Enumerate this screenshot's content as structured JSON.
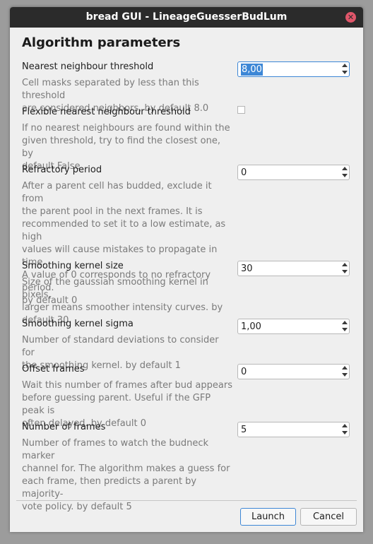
{
  "window": {
    "title": "bread GUI - LineageGuesserBudLum",
    "close_icon": "close-icon"
  },
  "heading": "Algorithm parameters",
  "params": [
    {
      "name": "Nearest neighbour threshold",
      "value": "8,00",
      "widget": "spinbox",
      "desc": [
        "Cell masks separated by less than this threshold",
        "are considered neighbors, by default 8.0"
      ]
    },
    {
      "name": "Flexible nearest neighbour threshold",
      "value": "unchecked",
      "widget": "checkbox",
      "desc": [
        "If no nearest neighbours are found within the",
        "given threshold, try to find the closest one, by",
        "default False"
      ]
    },
    {
      "name": "Refractory period",
      "value": "0",
      "widget": "spinbox",
      "desc": [
        "After a parent cell has budded, exclude it from",
        "the parent pool in the next frames. It is",
        "recommended to set it to a low estimate, as high",
        "values will cause mistakes to propagate in time.",
        "A value of 0 corresponds to no refractory period.",
        "by default 0"
      ]
    },
    {
      "name": "Smoothing kernel size",
      "value": "30",
      "widget": "spinbox",
      "desc": [
        "Size of the gaussian smoothing kernel in pixels,",
        "larger means smoother intensity curves. by",
        "default 30"
      ]
    },
    {
      "name": "Smoothing kernel sigma",
      "value": "1,00",
      "widget": "spinbox",
      "desc": [
        "Number of standard deviations to consider for",
        "the smoothing kernel. by default 1"
      ]
    },
    {
      "name": "Offset frames",
      "value": "0",
      "widget": "spinbox",
      "desc": [
        "Wait this number of frames after bud appears",
        "before guessing parent. Useful if the GFP peak is",
        "often delayed. by default 0"
      ]
    },
    {
      "name": "Number of frames",
      "value": "5",
      "widget": "spinbox",
      "desc": [
        "Number of frames to watch the budneck marker",
        "channel for. The algorithm makes a guess for",
        "each frame, then predicts a parent by majority-",
        "vote policy. by default 5"
      ]
    }
  ],
  "buttons": {
    "launch": "Launch",
    "cancel": "Cancel"
  },
  "colors": {
    "titlebar": "#2b2b2b",
    "accent": "#3d87d6",
    "close": "#e0566a",
    "description_text": "#7a7a7a"
  }
}
